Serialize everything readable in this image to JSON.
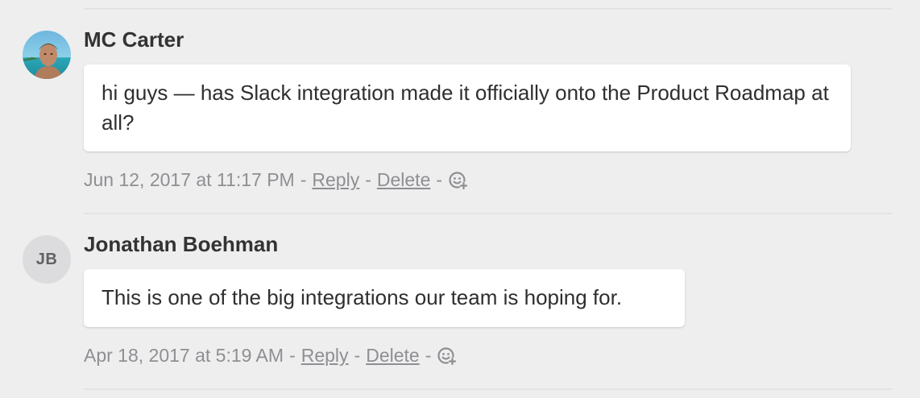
{
  "comments": [
    {
      "author": "MC Carter",
      "avatar": "photo",
      "text": "hi guys — has Slack integration made it officially onto the Product Roadmap at all?",
      "timestamp": "Jun 12, 2017 at 11:17 PM",
      "reply_label": "Reply",
      "delete_label": "Delete",
      "separator": "-",
      "reaction_icon": "add-reaction-icon"
    },
    {
      "author": "Jonathan Boehman",
      "avatar_initials": "JB",
      "text": "This is one of the big integrations our team is hoping for.",
      "timestamp": "Apr 18, 2017 at 5:19 AM",
      "reply_label": "Reply",
      "delete_label": "Delete",
      "separator": "-",
      "reaction_icon": "add-reaction-icon"
    }
  ],
  "colors": {
    "background": "#eeeeef",
    "bubble": "#ffffff",
    "meta_text": "#8e8f92",
    "author_text": "#333333",
    "initials_bg": "#dcdcde"
  }
}
